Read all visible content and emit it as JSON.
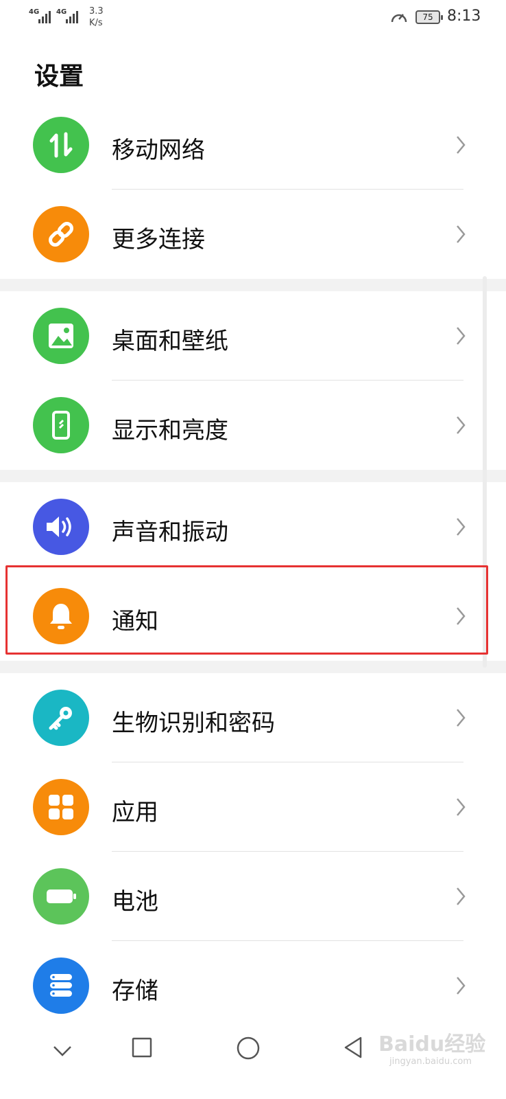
{
  "status_bar": {
    "signal1": "4G",
    "signal2": "4G",
    "speed_value": "3.3",
    "speed_unit": "K/s",
    "battery": "75",
    "time": "8:13"
  },
  "page_title": "设置",
  "items": [
    {
      "label": "移动网络",
      "icon": "up-down-arrows-icon",
      "color": "#43c24e"
    },
    {
      "label": "更多连接",
      "icon": "link-icon",
      "color": "#f78b0a"
    },
    {
      "label": "桌面和壁纸",
      "icon": "image-icon",
      "color": "#43c24e"
    },
    {
      "label": "显示和亮度",
      "icon": "phone-display-icon",
      "color": "#43c24e"
    },
    {
      "label": "声音和振动",
      "icon": "speaker-icon",
      "color": "#4758e3"
    },
    {
      "label": "通知",
      "icon": "bell-icon",
      "color": "#f78b0a"
    },
    {
      "label": "生物识别和密码",
      "icon": "key-icon",
      "color": "#1ab7c4"
    },
    {
      "label": "应用",
      "icon": "apps-grid-icon",
      "color": "#f78b0a"
    },
    {
      "label": "电池",
      "icon": "battery-icon",
      "color": "#5cc45a"
    },
    {
      "label": "存储",
      "icon": "storage-icon",
      "color": "#1f7de8"
    }
  ],
  "watermark": {
    "text": "Baidu经验",
    "sub": "jingyan.baidu.com"
  },
  "nav": {
    "items": [
      "down-chevron-icon",
      "recent-apps-icon",
      "home-icon",
      "back-icon"
    ]
  }
}
